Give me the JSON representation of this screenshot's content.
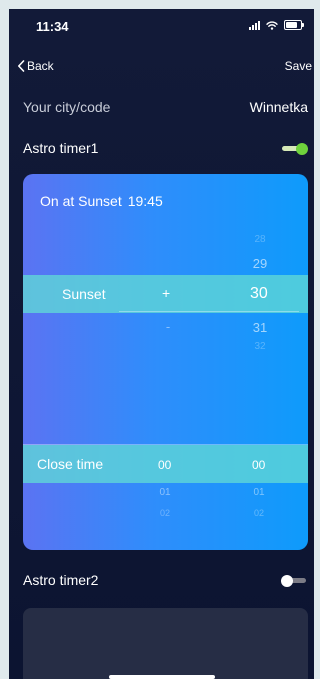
{
  "status_bar": {
    "time": "11:34"
  },
  "nav": {
    "back_label": "Back",
    "save_label": "Save"
  },
  "city": {
    "label": "Your city/code",
    "value": "Winnetka"
  },
  "timer1": {
    "label": "Astro timer1",
    "enabled": true,
    "summary_event": "On at Sunset",
    "summary_time": "19:45",
    "sunset_picker": {
      "event_label": "Sunset",
      "plus": "+",
      "minus": "-",
      "numbers_above": [
        "28",
        "29"
      ],
      "selected": "30",
      "numbers_below": [
        "31",
        "32"
      ]
    },
    "close_picker": {
      "label": "Close time",
      "hours_selected": "00",
      "hours_below": [
        "01",
        "02"
      ],
      "minutes_selected": "00",
      "minutes_below": [
        "01",
        "02"
      ]
    }
  },
  "timer2": {
    "label": "Astro timer2",
    "enabled": false
  },
  "colors": {
    "background": "#0c1431",
    "accent_green": "#6fd23c",
    "picker_band": "#60d8d6",
    "card_gradient_start": "#5b73f2",
    "card_gradient_end": "#0e9bfb"
  }
}
